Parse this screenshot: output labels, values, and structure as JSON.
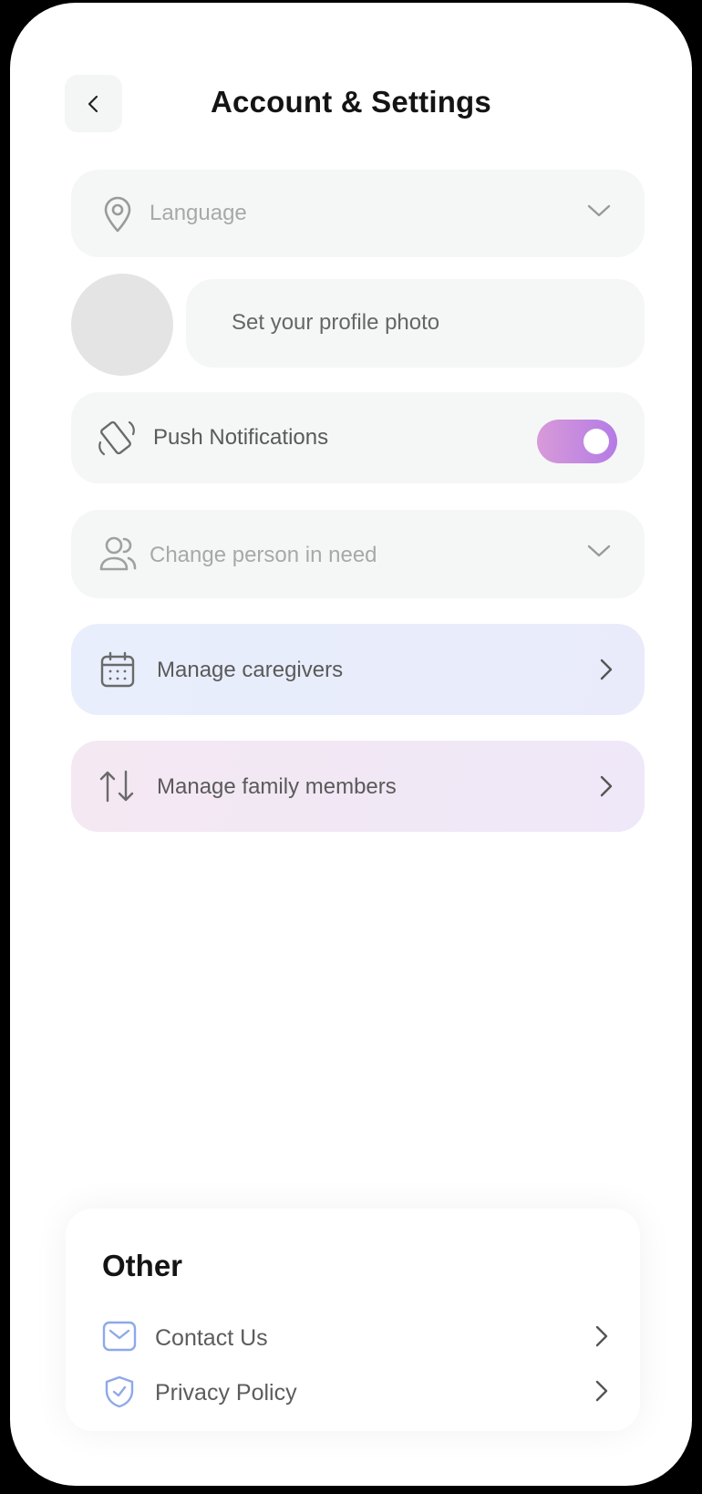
{
  "header": {
    "title": "Account & Settings"
  },
  "settings": {
    "language_placeholder": "Language",
    "profile_photo_label": "Set your profile photo",
    "push_notifications_label": "Push Notifications",
    "push_notifications_enabled": true,
    "person_in_need_placeholder": "Change person in need",
    "manage_caregivers_label": "Manage caregivers",
    "manage_family_label": "Manage family members"
  },
  "other": {
    "title": "Other",
    "items": [
      {
        "label": "Contact Us",
        "icon": "mail-icon"
      },
      {
        "label": "Privacy Policy",
        "icon": "shield-check-icon"
      }
    ]
  },
  "colors": {
    "toggle_on_start": "#d89ad8",
    "toggle_on_end": "#b47be6",
    "card_bg": "#f5f7f6",
    "caregivers_bg": "#e8eefb",
    "family_bg": "#f4e8f2",
    "accent_blue_icon": "#8fa8ea"
  }
}
